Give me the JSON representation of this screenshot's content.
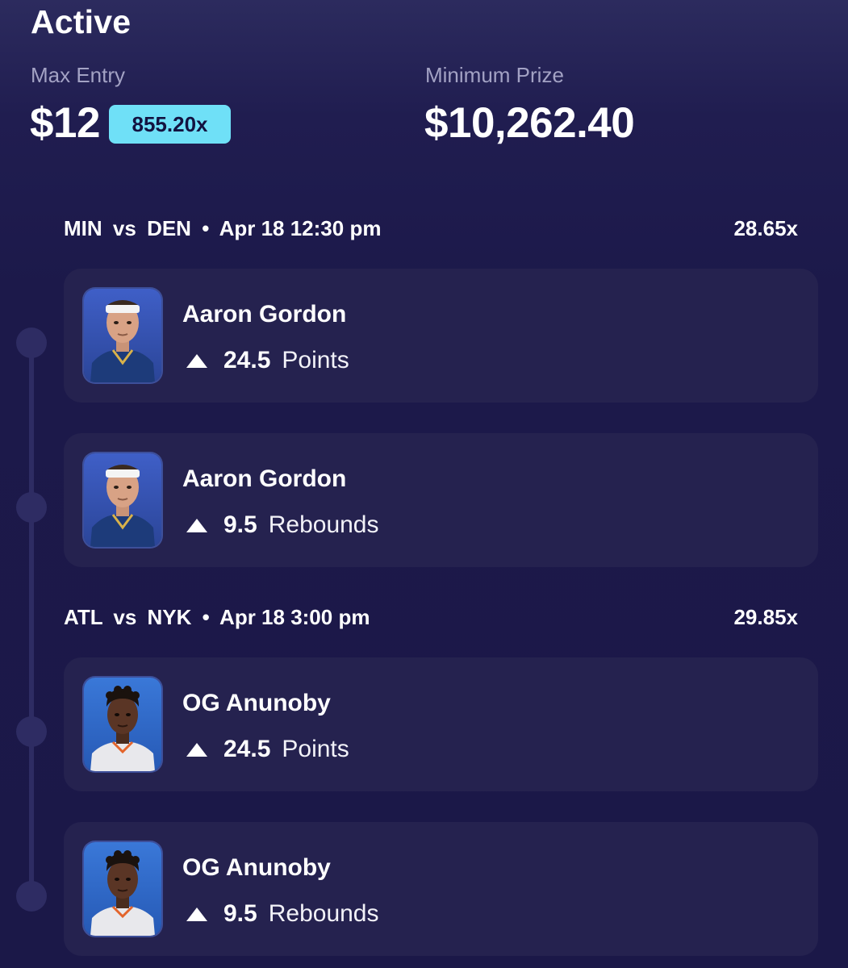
{
  "header": {
    "title": "Active",
    "max_entry_label": "Max Entry",
    "max_entry_value": "$12",
    "multiplier": "855.20x",
    "min_prize_label": "Minimum Prize",
    "min_prize_value": "$10,262.40"
  },
  "games": [
    {
      "team1": "MIN",
      "vs": "vs",
      "team2": "DEN",
      "separator": "•",
      "datetime": "Apr 18 12:30 pm",
      "multiplier": "28.65x",
      "picks": [
        {
          "player": "Aaron Gordon",
          "direction": "up-arrow-icon",
          "line": "24.5",
          "stat": "Points",
          "jersey_color": "#1d3b7a"
        },
        {
          "player": "Aaron Gordon",
          "direction": "up-arrow-icon",
          "line": "9.5",
          "stat": "Rebounds",
          "jersey_color": "#1d3b7a"
        }
      ]
    },
    {
      "team1": "ATL",
      "vs": "vs",
      "team2": "NYK",
      "separator": "•",
      "datetime": "Apr 18 3:00 pm",
      "multiplier": "29.85x",
      "picks": [
        {
          "player": "OG Anunoby",
          "direction": "up-arrow-icon",
          "line": "24.5",
          "stat": "Points",
          "jersey_color": "#e8e8ec"
        },
        {
          "player": "OG Anunoby",
          "direction": "up-arrow-icon",
          "line": "9.5",
          "stat": "Rebounds",
          "jersey_color": "#e8e8ec"
        }
      ]
    }
  ],
  "colors": {
    "background": "#1c194a",
    "card": "#25224f",
    "badge": "#6fe0f7",
    "label": "#a3a2c4"
  }
}
